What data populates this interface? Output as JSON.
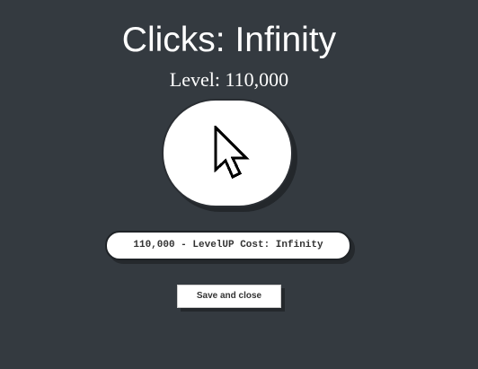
{
  "game": {
    "clicks_text": "Clicks: Infinity",
    "level_text": "Level: 110,000",
    "levelup_label": "110,000 - LevelUP Cost: Infinity",
    "save_label": "Save and close"
  },
  "icons": {
    "click_button_icon": "mouse-pointer-icon"
  },
  "colors": {
    "background": "#343a40",
    "button_background": "#ffffff",
    "title_text": "#ffffff"
  }
}
